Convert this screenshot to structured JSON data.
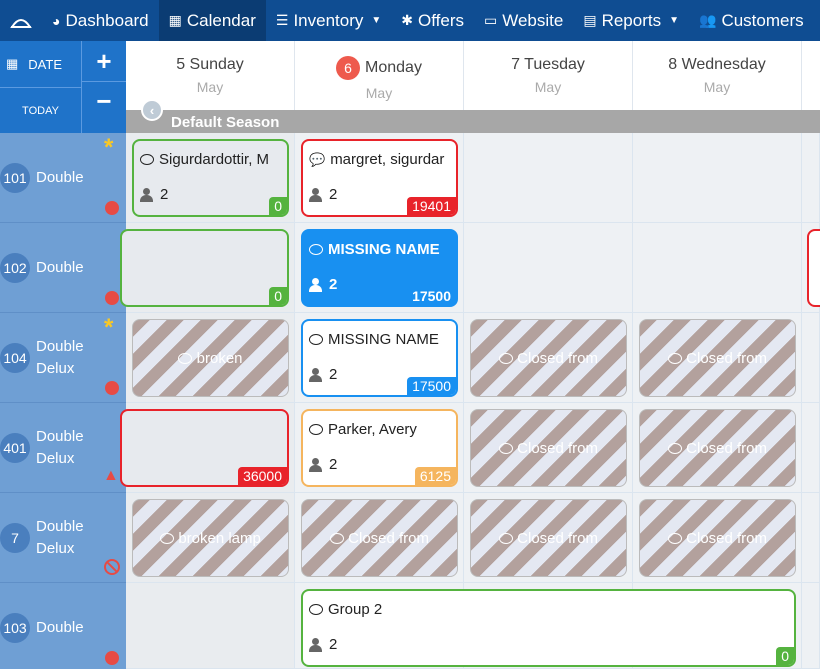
{
  "nav": {
    "items": [
      {
        "icon": "dashboard-icon",
        "label": "Dashboard",
        "active": false,
        "caret": false
      },
      {
        "icon": "calendar-icon",
        "label": "Calendar",
        "active": true,
        "caret": false
      },
      {
        "icon": "database-icon",
        "label": "Inventory",
        "active": false,
        "caret": true
      },
      {
        "icon": "gear-icon",
        "label": "Offers",
        "active": false,
        "caret": false
      },
      {
        "icon": "monitor-icon",
        "label": "Website",
        "active": false,
        "caret": false
      },
      {
        "icon": "document-icon",
        "label": "Reports",
        "active": false,
        "caret": true
      },
      {
        "icon": "users-icon",
        "label": "Customers",
        "active": false,
        "caret": false
      }
    ]
  },
  "controls": {
    "date_label": "DATE",
    "today_label": "TODAY",
    "plus": "+",
    "minus": "−"
  },
  "days": [
    {
      "day": "5 Sunday",
      "month": "May",
      "badge": ""
    },
    {
      "day": "Monday",
      "month": "May",
      "badge": "6"
    },
    {
      "day": "7 Tuesday",
      "month": "May",
      "badge": ""
    },
    {
      "day": "8 Wednesday",
      "month": "May",
      "badge": ""
    }
  ],
  "season": "Default Season",
  "rooms": [
    {
      "number": "101",
      "type": "Double",
      "marker": "star",
      "status": "dot"
    },
    {
      "number": "102",
      "type": "Double",
      "marker": "",
      "status": "dot"
    },
    {
      "number": "104",
      "type": "Double Delux",
      "marker": "star",
      "status": "dot"
    },
    {
      "number": "401",
      "type": "Double Delux",
      "marker": "",
      "status": "warning"
    },
    {
      "number": "7",
      "type": "Double Delux",
      "marker": "",
      "status": "ban"
    },
    {
      "number": "103",
      "type": "Double",
      "marker": "",
      "status": "dot"
    }
  ],
  "bookings": [
    {
      "name": "Sigurdardottir, M",
      "guests": "2",
      "price": "0",
      "border": "#55b33f",
      "priceColor": "#55b33f",
      "style": "grey"
    },
    {
      "name": "margret, sigurdar",
      "guests": "2",
      "price": "19401",
      "border": "#e8232a",
      "priceColor": "#e8232a",
      "style": "white"
    },
    {
      "name": "",
      "guests": "",
      "price": "0",
      "border": "#55b33f",
      "priceColor": "#55b33f",
      "style": "grey"
    },
    {
      "name": "MISSING NAME",
      "guests": "2",
      "price": "17500",
      "border": "#1890f1",
      "priceColor": "#1890f1",
      "style": "blue"
    },
    {
      "name": "MISSING NAME",
      "guests": "2",
      "price": "17500",
      "border": "#1890f1",
      "priceColor": "#1890f1",
      "style": "white"
    },
    {
      "name": "",
      "guests": "",
      "price": "36000",
      "border": "#e8232a",
      "priceColor": "#e8232a",
      "style": "grey"
    },
    {
      "name": "Parker, Avery",
      "guests": "2",
      "price": "6125",
      "border": "#f5b55e",
      "priceColor": "#f5b55e",
      "style": "white"
    },
    {
      "name": "Group 2",
      "guests": "2",
      "price": "0",
      "border": "#55b33f",
      "priceColor": "#55b33f",
      "style": "white"
    }
  ],
  "closed_blocks": [
    {
      "label": "broken"
    },
    {
      "label": "Closed from"
    },
    {
      "label": "Closed from"
    },
    {
      "label": "Closed from"
    },
    {
      "label": "Closed from"
    },
    {
      "label": "broken lamp"
    },
    {
      "label": "Closed from"
    },
    {
      "label": "Closed from"
    },
    {
      "label": "Closed from"
    }
  ]
}
